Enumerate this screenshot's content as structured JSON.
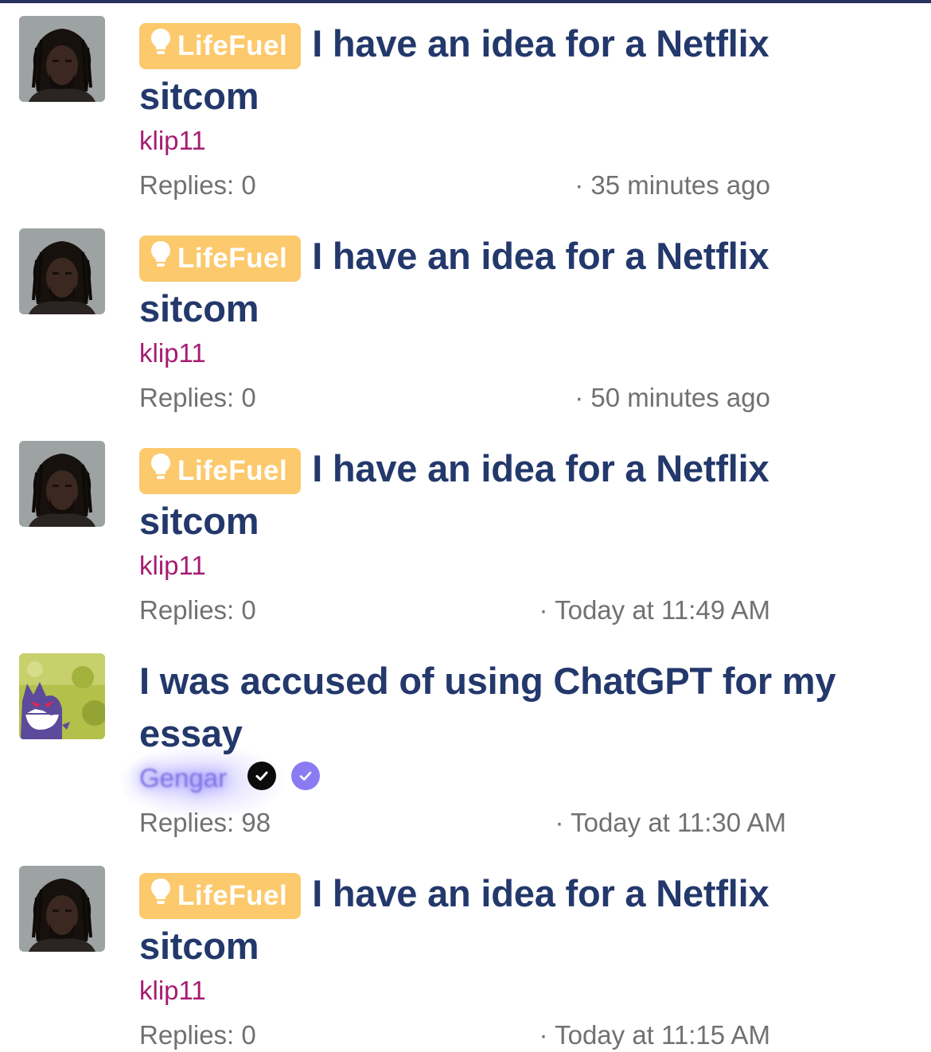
{
  "threads": [
    {
      "prefix": "LifeFuel",
      "title_line1": "I have an idea for a Netflix",
      "title_line2": "sitcom",
      "author": "klip11",
      "replies": "Replies: 0",
      "time": "· 35 minutes ago",
      "avatar": "user-photo"
    },
    {
      "prefix": "LifeFuel",
      "title_line1": "I have an idea for a Netflix",
      "title_line2": "sitcom",
      "author": "klip11",
      "replies": "Replies: 0",
      "time": "· 50 minutes ago",
      "avatar": "user-photo"
    },
    {
      "prefix": "LifeFuel",
      "title_line1": "I have an idea for a Netflix",
      "title_line2": "sitcom",
      "author": "klip11",
      "replies": "Replies: 0",
      "time": "· Today at 11:49 AM",
      "avatar": "user-photo"
    },
    {
      "title_line1": "I was accused of using ChatGPT for my",
      "title_line2": "essay",
      "author": "Gengar",
      "replies": "Replies: 98",
      "time": "· Today at 11:30 AM",
      "avatar": "gengar-avatar",
      "badges": [
        "check-circle-icon",
        "verified-check-icon"
      ]
    },
    {
      "prefix": "LifeFuel",
      "title_line1": "I have an idea for a Netflix",
      "title_line2": "sitcom",
      "author": "klip11",
      "replies": "Replies: 0",
      "time": "· Today at 11:15 AM",
      "avatar": "user-photo"
    }
  ],
  "colors": {
    "title": "#23386b",
    "prefix_bg": "#fcc96c",
    "author": "#a51d72",
    "meta": "#717171",
    "topbar": "#27325e"
  }
}
